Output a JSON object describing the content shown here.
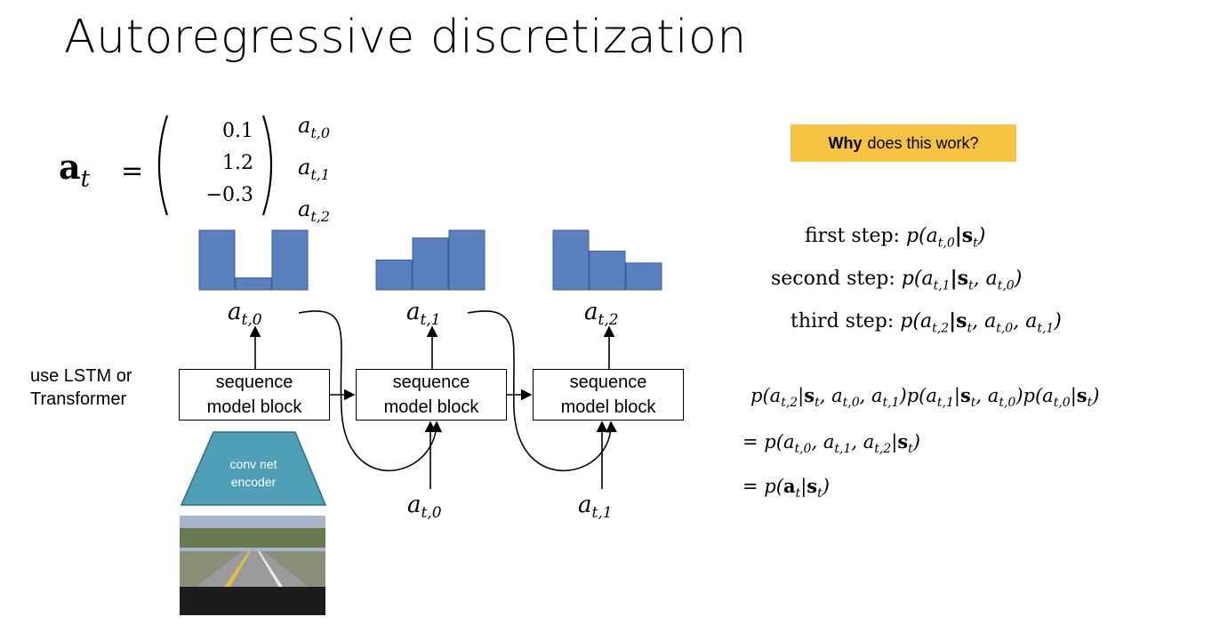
{
  "slide": {
    "title": "Autoregressive discretization",
    "vector": {
      "lhs": "a",
      "lhs_sub": "t",
      "values": [
        "0.1",
        "1.2",
        "−0.3"
      ],
      "labels": [
        "a",
        "a",
        "a"
      ],
      "label_subs": [
        "t,0",
        "t,1",
        "t,2"
      ]
    },
    "histograms": [
      {
        "values": [
          1.0,
          0.2,
          1.0
        ]
      },
      {
        "values": [
          0.5,
          0.87,
          1.0
        ]
      },
      {
        "values": [
          1.0,
          0.65,
          0.45
        ]
      }
    ],
    "outputs": [
      {
        "var": "a",
        "sub": "t,0"
      },
      {
        "var": "a",
        "sub": "t,1"
      },
      {
        "var": "a",
        "sub": "t,2"
      }
    ],
    "inputs": [
      {
        "var": "a",
        "sub": "t,0"
      },
      {
        "var": "a",
        "sub": "t,1"
      }
    ],
    "side_label": [
      "use LSTM or",
      "Transformer"
    ],
    "blocks": [
      {
        "line1": "sequence",
        "line2": "model block"
      },
      {
        "line1": "sequence",
        "line2": "model block"
      },
      {
        "line1": "sequence",
        "line2": "model block"
      }
    ],
    "encoder": {
      "line1": "conv net",
      "line2": "encoder"
    },
    "why": {
      "bold": "Why",
      "rest": "does this work?"
    },
    "steps": [
      {
        "label": "first step:",
        "expr": "p(a",
        "expr_sub": "t,0",
        "expr_rest": "|s",
        "expr_rest_sub": "t",
        "expr_end": ")"
      },
      {
        "label": "second step:",
        "expr": "p(a",
        "expr_sub": "t,1",
        "expr_rest": "|s",
        "expr_rest_sub": "t",
        "expr_end": ", a",
        "expr_end_sub": "t,0",
        "expr_close": ")"
      },
      {
        "label": "third step:",
        "expr": "p(a",
        "expr_sub": "t,2",
        "expr_rest": "|s",
        "expr_rest_sub": "t",
        "expr_end": ", a",
        "expr_end_sub": "t,0",
        "expr_close": ", a",
        "expr_close_sub": "t,1",
        "expr_final": ")"
      }
    ],
    "equations": [
      "p(a_{t,2}|s_t, a_{t,0}, a_{t,1})p(a_{t,1}|s_t, a_{t,0})p(a_{t,0}|s_t)",
      "= p(a_{t,0}, a_{t,1}, a_{t,2}|s_t)",
      "= p(a_t|s_t)"
    ],
    "colors": {
      "bar": "#5b80bf",
      "bar_stroke": "#3d5f9a",
      "encoder": "#4fa0b6",
      "why_bg": "#f5c242"
    }
  }
}
